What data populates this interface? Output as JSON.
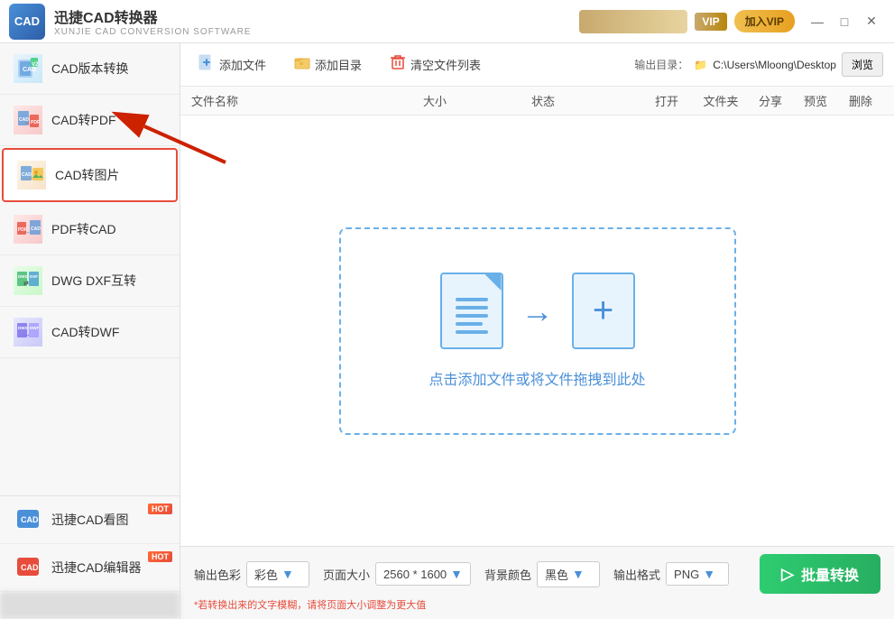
{
  "titleBar": {
    "appName": "迅捷CAD转换器",
    "appSub": "XUNJIE CAD CONVERSION SOFTWARE",
    "logoText": "CAD",
    "joinVip": "加入VIP",
    "controls": [
      "—",
      "□",
      "×"
    ]
  },
  "sidebar": {
    "items": [
      {
        "id": "cad-version",
        "label": "CAD版本转换",
        "active": false
      },
      {
        "id": "cad-pdf",
        "label": "CAD转PDF",
        "active": false
      },
      {
        "id": "cad-img",
        "label": "CAD转图片",
        "active": true
      },
      {
        "id": "pdf-cad",
        "label": "PDF转CAD",
        "active": false
      },
      {
        "id": "dwg-dxf",
        "label": "DWG DXF互转",
        "active": false
      },
      {
        "id": "cad-dwf",
        "label": "CAD转DWF",
        "active": false
      }
    ],
    "bottomItems": [
      {
        "id": "cad-viewer",
        "label": "迅捷CAD看图",
        "hot": true
      },
      {
        "id": "cad-editor",
        "label": "迅捷CAD编辑器",
        "hot": true
      }
    ]
  },
  "toolbar": {
    "addFile": "添加文件",
    "addDir": "添加目录",
    "clearList": "清空文件列表",
    "outputDirLabel": "输出目录：",
    "outputPath": "C:\\Users\\Mloong\\Desktop",
    "browseLabel": "浏览"
  },
  "tableHeader": {
    "name": "文件名称",
    "size": "大小",
    "status": "状态",
    "open": "打开",
    "folder": "文件夹",
    "share": "分享",
    "preview": "预览",
    "delete": "删除"
  },
  "dropZone": {
    "text": "点击添加文件或将文件拖拽到此处"
  },
  "bottomBar": {
    "outputColorLabel": "输出色彩",
    "outputColorValue": "彩色",
    "pageSizeLabel": "页面大小",
    "pageSizeValue": "2560 * 1600",
    "bgColorLabel": "背景颜色",
    "bgColorValue": "黑色",
    "outputFormatLabel": "输出格式",
    "outputFormatValue": "PNG",
    "hint": "*若转换出来的文字模糊，请将页面大小调整为更大值",
    "convertBtn": "批量转换"
  }
}
